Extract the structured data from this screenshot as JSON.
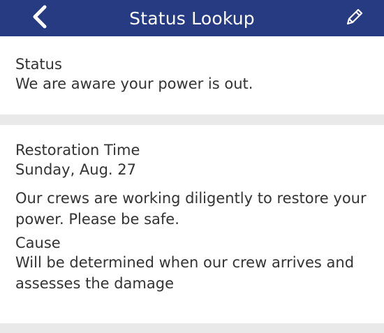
{
  "header": {
    "title": "Status Lookup",
    "back_icon": "chevron-left-icon",
    "edit_icon": "pencil-icon",
    "background_color": "#263b82"
  },
  "status_card": {
    "label": "Status",
    "value": "We are aware your power is out."
  },
  "restoration_card": {
    "label": "Restoration Time",
    "date": "Sunday, Aug. 27",
    "message": "Our crews are working diligently to restore your power. Please be safe.",
    "cause_label": "Cause",
    "cause_value": "Will be determined when our crew arrives and assesses the damage"
  }
}
